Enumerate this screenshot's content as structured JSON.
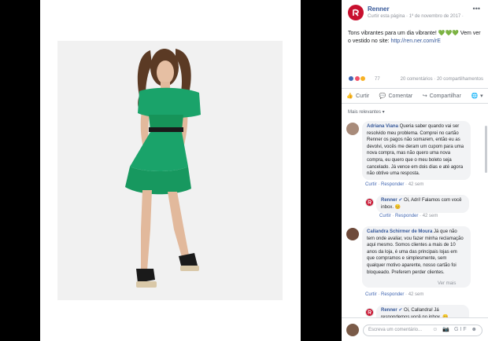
{
  "page": {
    "name": "Renner",
    "subtitle": "Curtir esta página · 1º de novembro de 2017 ·",
    "post_text": "Tons vibrantes para um dia vibrante! 💚💚💚 Vem ver o vestido no site:",
    "post_link": "http://ren.ner.com/rE"
  },
  "reactions": {
    "count": "77",
    "comments_shares": "20 comentários · 20 compartilhamentos"
  },
  "actions": {
    "like": "Curtir",
    "comment": "Comentar",
    "share": "Compartilhar"
  },
  "sort_label": "Mais relevantes ▾",
  "comments": [
    {
      "author": "Adriana Viana",
      "text": "Queria saber quando vai ser resolvido meu problema. Comprei no cartão Renner os pagos não somarem, então eu as devolvi, vocês me deram um cupom para uma nova compra, mas não quero uma nova compra, eu quero que o meu boleto seja cancelado. Já vence em dois dias e até agora não obtive uma resposta.",
      "like": "Curtir",
      "reply": "Responder",
      "time": "42 sem"
    },
    {
      "author": "Renner",
      "text": "Oi, Adri! Falamos com você inbox. 😊",
      "like": "Curtir",
      "reply": "Responder",
      "time": "42 sem"
    },
    {
      "author": "Callandra Schirmer de Moura",
      "text": "Já que não tem onde avaliar, vou fazer minha reclamação aqui mesmo. Somos clientes a mais de 10 anos da loja, é uma das principais lojas em que compramos e simplesmente, sem qualquer motivo aparente, nosso cartão foi bloqueado. Preferem perder clientes.",
      "more": "Ver mais",
      "like": "Curtir",
      "reply": "Responder",
      "time": "42 sem"
    },
    {
      "author": "Renner",
      "text": "Oi, Callandra! Já respondemos você no inbox. 😊"
    }
  ],
  "input_placeholder": "Escreva um comentário...",
  "input_icons": "☺ 📷 GIF ☻",
  "colors": {
    "brand_red": "#c8102e",
    "fb_link": "#365899",
    "dress_green": "#1aa36a"
  }
}
